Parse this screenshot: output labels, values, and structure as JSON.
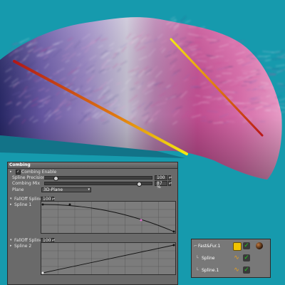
{
  "combing_panel": {
    "title": "Combing",
    "combing_enable": {
      "label": "Combing Enable",
      "checked": true
    },
    "spline_precision": {
      "label": "Spline Precision",
      "value": "100",
      "level": 0.09
    },
    "combing_mix": {
      "label": "Combing Mix",
      "value": "87 %",
      "level": 0.87
    },
    "plane": {
      "label": "Plane",
      "selected": "3D-Plane"
    },
    "falloff_spline_1": {
      "label": "FallOff Spline 1",
      "value": "100"
    },
    "spline_1": {
      "label": "Spline 1"
    },
    "falloff_spline_2": {
      "label": "FallOff Spline 2",
      "value": "100"
    },
    "spline_2": {
      "label": "Spline 2"
    }
  },
  "object_manager": {
    "items": [
      {
        "name": "Fast&Fur.1",
        "icon": "fastfur-icon"
      },
      {
        "name": "Spline",
        "icon": "spline-icon"
      },
      {
        "name": "Spline.1",
        "icon": "spline-icon"
      }
    ],
    "colors": {
      "enabled_check": "#22cc22",
      "tag_yellow": "#f0c400",
      "material_dark": "#2a1508"
    }
  },
  "colors": {
    "background": "#169aad",
    "guide_spline_start": "#b01818",
    "guide_spline_end": "#f4ec10"
  }
}
